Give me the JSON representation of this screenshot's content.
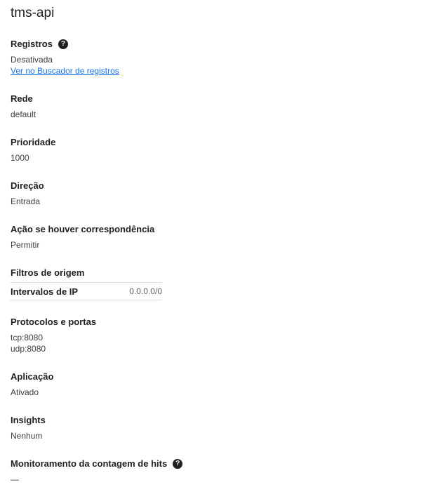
{
  "title": "tms-api",
  "sections": {
    "logs": {
      "label": "Registros",
      "value": "Desativada",
      "link": "Ver no Buscador de registros"
    },
    "network": {
      "label": "Rede",
      "value": "default"
    },
    "priority": {
      "label": "Prioridade",
      "value": "1000"
    },
    "direction": {
      "label": "Direção",
      "value": "Entrada"
    },
    "action": {
      "label": "Ação se houver correspondência",
      "value": "Permitir"
    },
    "source_filters": {
      "label": "Filtros de origem",
      "ip_ranges_label": "Intervalos de IP",
      "ip_ranges_value": "0.0.0.0/0"
    },
    "protocols": {
      "label": "Protocolos e portas",
      "values": [
        "tcp:8080",
        "udp:8080"
      ]
    },
    "enforcement": {
      "label": "Aplicação",
      "value": "Ativado"
    },
    "insights": {
      "label": "Insights",
      "value": "Nenhum"
    },
    "hit_count": {
      "label": "Monitoramento da contagem de hits",
      "value": "—"
    }
  },
  "icons": {
    "help": "help-circle-icon",
    "help_glyph": "?"
  }
}
